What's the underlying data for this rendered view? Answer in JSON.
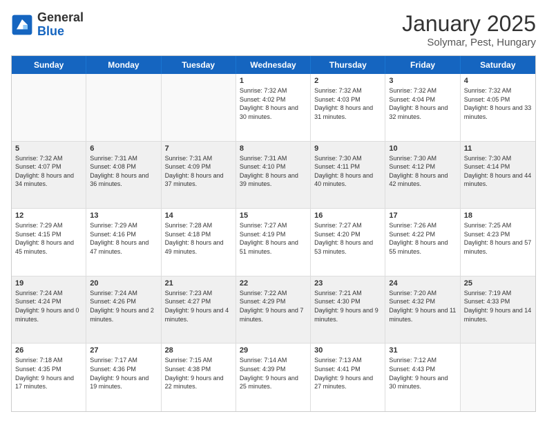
{
  "logo": {
    "general": "General",
    "blue": "Blue"
  },
  "title": "January 2025",
  "subtitle": "Solymar, Pest, Hungary",
  "header_days": [
    "Sunday",
    "Monday",
    "Tuesday",
    "Wednesday",
    "Thursday",
    "Friday",
    "Saturday"
  ],
  "weeks": [
    [
      {
        "day": "",
        "info": "",
        "empty": true
      },
      {
        "day": "",
        "info": "",
        "empty": true
      },
      {
        "day": "",
        "info": "",
        "empty": true
      },
      {
        "day": "1",
        "info": "Sunrise: 7:32 AM\nSunset: 4:02 PM\nDaylight: 8 hours\nand 30 minutes.",
        "empty": false
      },
      {
        "day": "2",
        "info": "Sunrise: 7:32 AM\nSunset: 4:03 PM\nDaylight: 8 hours\nand 31 minutes.",
        "empty": false
      },
      {
        "day": "3",
        "info": "Sunrise: 7:32 AM\nSunset: 4:04 PM\nDaylight: 8 hours\nand 32 minutes.",
        "empty": false
      },
      {
        "day": "4",
        "info": "Sunrise: 7:32 AM\nSunset: 4:05 PM\nDaylight: 8 hours\nand 33 minutes.",
        "empty": false
      }
    ],
    [
      {
        "day": "5",
        "info": "Sunrise: 7:32 AM\nSunset: 4:07 PM\nDaylight: 8 hours\nand 34 minutes.",
        "empty": false
      },
      {
        "day": "6",
        "info": "Sunrise: 7:31 AM\nSunset: 4:08 PM\nDaylight: 8 hours\nand 36 minutes.",
        "empty": false
      },
      {
        "day": "7",
        "info": "Sunrise: 7:31 AM\nSunset: 4:09 PM\nDaylight: 8 hours\nand 37 minutes.",
        "empty": false
      },
      {
        "day": "8",
        "info": "Sunrise: 7:31 AM\nSunset: 4:10 PM\nDaylight: 8 hours\nand 39 minutes.",
        "empty": false
      },
      {
        "day": "9",
        "info": "Sunrise: 7:30 AM\nSunset: 4:11 PM\nDaylight: 8 hours\nand 40 minutes.",
        "empty": false
      },
      {
        "day": "10",
        "info": "Sunrise: 7:30 AM\nSunset: 4:12 PM\nDaylight: 8 hours\nand 42 minutes.",
        "empty": false
      },
      {
        "day": "11",
        "info": "Sunrise: 7:30 AM\nSunset: 4:14 PM\nDaylight: 8 hours\nand 44 minutes.",
        "empty": false
      }
    ],
    [
      {
        "day": "12",
        "info": "Sunrise: 7:29 AM\nSunset: 4:15 PM\nDaylight: 8 hours\nand 45 minutes.",
        "empty": false
      },
      {
        "day": "13",
        "info": "Sunrise: 7:29 AM\nSunset: 4:16 PM\nDaylight: 8 hours\nand 47 minutes.",
        "empty": false
      },
      {
        "day": "14",
        "info": "Sunrise: 7:28 AM\nSunset: 4:18 PM\nDaylight: 8 hours\nand 49 minutes.",
        "empty": false
      },
      {
        "day": "15",
        "info": "Sunrise: 7:27 AM\nSunset: 4:19 PM\nDaylight: 8 hours\nand 51 minutes.",
        "empty": false
      },
      {
        "day": "16",
        "info": "Sunrise: 7:27 AM\nSunset: 4:20 PM\nDaylight: 8 hours\nand 53 minutes.",
        "empty": false
      },
      {
        "day": "17",
        "info": "Sunrise: 7:26 AM\nSunset: 4:22 PM\nDaylight: 8 hours\nand 55 minutes.",
        "empty": false
      },
      {
        "day": "18",
        "info": "Sunrise: 7:25 AM\nSunset: 4:23 PM\nDaylight: 8 hours\nand 57 minutes.",
        "empty": false
      }
    ],
    [
      {
        "day": "19",
        "info": "Sunrise: 7:24 AM\nSunset: 4:24 PM\nDaylight: 9 hours\nand 0 minutes.",
        "empty": false
      },
      {
        "day": "20",
        "info": "Sunrise: 7:24 AM\nSunset: 4:26 PM\nDaylight: 9 hours\nand 2 minutes.",
        "empty": false
      },
      {
        "day": "21",
        "info": "Sunrise: 7:23 AM\nSunset: 4:27 PM\nDaylight: 9 hours\nand 4 minutes.",
        "empty": false
      },
      {
        "day": "22",
        "info": "Sunrise: 7:22 AM\nSunset: 4:29 PM\nDaylight: 9 hours\nand 7 minutes.",
        "empty": false
      },
      {
        "day": "23",
        "info": "Sunrise: 7:21 AM\nSunset: 4:30 PM\nDaylight: 9 hours\nand 9 minutes.",
        "empty": false
      },
      {
        "day": "24",
        "info": "Sunrise: 7:20 AM\nSunset: 4:32 PM\nDaylight: 9 hours\nand 11 minutes.",
        "empty": false
      },
      {
        "day": "25",
        "info": "Sunrise: 7:19 AM\nSunset: 4:33 PM\nDaylight: 9 hours\nand 14 minutes.",
        "empty": false
      }
    ],
    [
      {
        "day": "26",
        "info": "Sunrise: 7:18 AM\nSunset: 4:35 PM\nDaylight: 9 hours\nand 17 minutes.",
        "empty": false
      },
      {
        "day": "27",
        "info": "Sunrise: 7:17 AM\nSunset: 4:36 PM\nDaylight: 9 hours\nand 19 minutes.",
        "empty": false
      },
      {
        "day": "28",
        "info": "Sunrise: 7:15 AM\nSunset: 4:38 PM\nDaylight: 9 hours\nand 22 minutes.",
        "empty": false
      },
      {
        "day": "29",
        "info": "Sunrise: 7:14 AM\nSunset: 4:39 PM\nDaylight: 9 hours\nand 25 minutes.",
        "empty": false
      },
      {
        "day": "30",
        "info": "Sunrise: 7:13 AM\nSunset: 4:41 PM\nDaylight: 9 hours\nand 27 minutes.",
        "empty": false
      },
      {
        "day": "31",
        "info": "Sunrise: 7:12 AM\nSunset: 4:43 PM\nDaylight: 9 hours\nand 30 minutes.",
        "empty": false
      },
      {
        "day": "",
        "info": "",
        "empty": true
      }
    ]
  ]
}
